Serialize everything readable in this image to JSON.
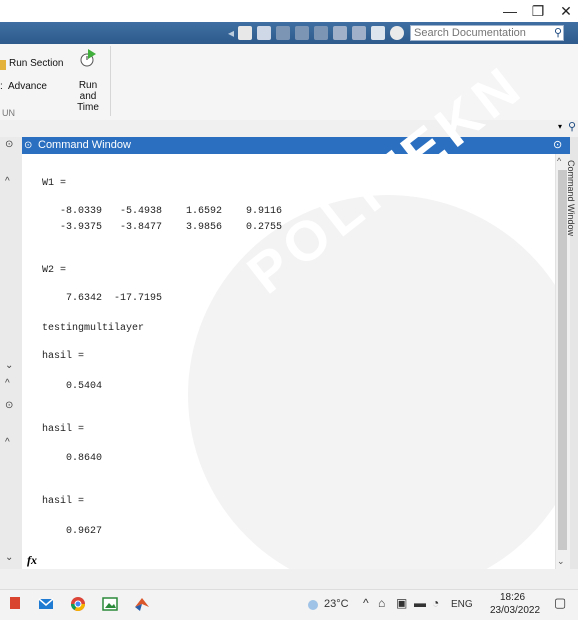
{
  "window": {
    "minimize": "—",
    "restore": "❐",
    "close": "✕"
  },
  "search": {
    "placeholder": "Search Documentation"
  },
  "ribbon": {
    "run_section": "Run Section",
    "advance": "Advance",
    "run_and_time": "Run and\nTime",
    "section_label": "UN"
  },
  "command_window": {
    "title": "Command Window",
    "lines": [
      "W1 =",
      "   -8.0339   -5.4938    1.6592    9.9116",
      "   -3.9375   -3.8477    3.9856    0.2755",
      "W2 =",
      "    7.6342  -17.7195",
      "testingmultilayer",
      "hasil =",
      "    0.5404",
      "hasil =",
      "    0.8640",
      "hasil =",
      "    0.9627"
    ],
    "prompt": "fx",
    "side_label": "Command Window"
  },
  "watermark": "POLITEKN",
  "taskbar": {
    "temperature": "23°C",
    "language": "ENG",
    "time": "18:26",
    "date": "23/03/2022"
  },
  "colors": {
    "title_blue": "#2a6fc0",
    "toolbar_blue": "#2e5a8c",
    "taskbar_bg": "#f3f3f3"
  }
}
